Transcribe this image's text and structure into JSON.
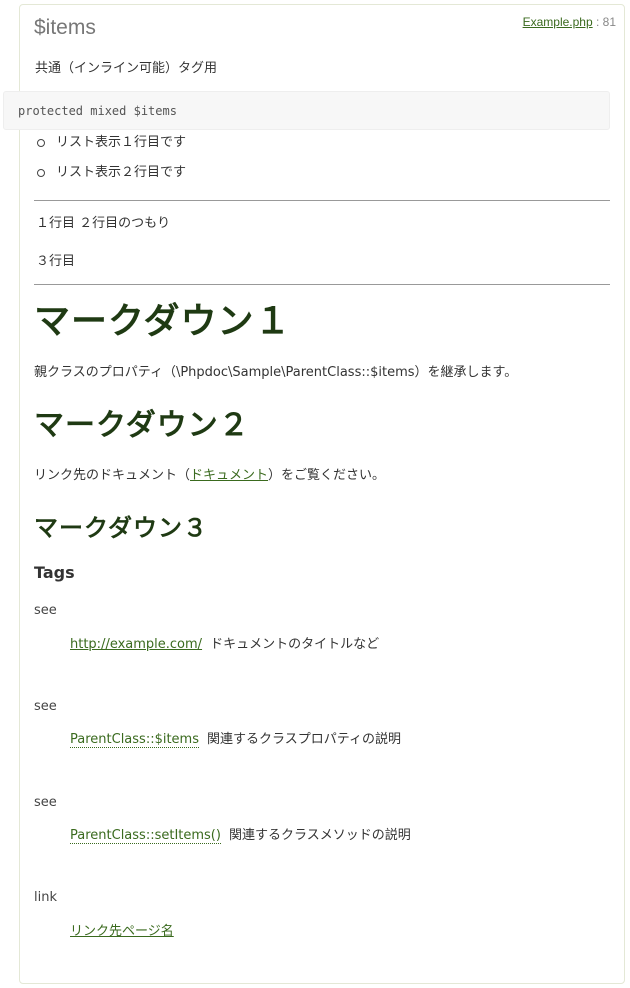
{
  "property": {
    "name": "$items",
    "file_name": "Example.php",
    "line_text": ": 81",
    "summary": "共通（インライン可能）タグ用",
    "signature": "protected mixed $items"
  },
  "list_items": [
    "リスト表示１行目です",
    "リスト表示２行目です"
  ],
  "paragraphs": [
    "１行目 ２行目のつもり",
    "３行目"
  ],
  "markdown": {
    "h1": "マークダウン１",
    "h1_text": "親クラスのプロパティ（\\Phpdoc\\Sample\\ParentClass::$items）を継承します。",
    "h2": "マークダウン２",
    "h2_text_before": "リンク先のドキュメント（",
    "h2_link": "ドキュメント",
    "h2_text_after": "）をご覧ください。",
    "h3": "マークダウン３"
  },
  "tags": {
    "title": "Tags",
    "items": [
      {
        "name": "see",
        "link": "http://example.com/",
        "desc": "ドキュメントのタイトルなど"
      },
      {
        "name": "see",
        "link": "ParentClass::$items",
        "desc": "関連するクラスプロパティの説明"
      },
      {
        "name": "see",
        "link": "ParentClass::setItems()",
        "desc": "関連するクラスメソッドの説明"
      },
      {
        "name": "link",
        "link": "リンク先ページ名",
        "desc": ""
      }
    ]
  },
  "colors": {
    "heading": "#1f3a13",
    "link": "#3a6a1e",
    "card_border": "#e4e8d6"
  }
}
